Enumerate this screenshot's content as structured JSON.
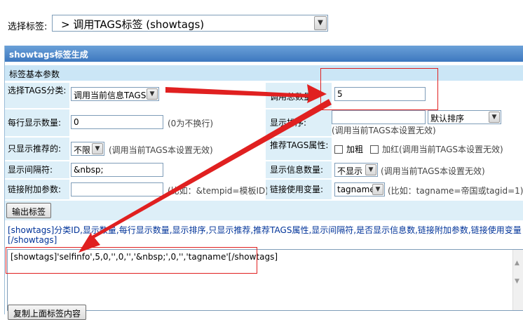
{
  "top": {
    "label": "选择标签:",
    "select_value": "> 调用TAGS标签 (showtags)"
  },
  "panel": {
    "title": "showtags标签生成",
    "section": "标签基本参数"
  },
  "fields": {
    "category_label": "选择TAGS分类:",
    "category_value": "调用当前信息TAGS",
    "total_label": "调用总数量:",
    "total_value": "5",
    "perline_label": "每行显示数量:",
    "perline_value": "0",
    "perline_hint": "(0为不换行)",
    "order_label": "显示排序:",
    "order_value": "",
    "order_select": "默认排序",
    "order_hint": "(调用当前TAGS本设置无效)",
    "recommend_label": "只显示推荐的:",
    "recommend_value": "不限",
    "recommend_hint": "(调用当前TAGS本设置无效)",
    "attr_label": "推荐TAGS属性:",
    "attr_bold": "加粗",
    "attr_red": "加红(调用当前TAGS本设置无效)",
    "sep_label": "显示间隔符:",
    "sep_value": "&nbsp;",
    "count_label": "显示信息数量:",
    "count_value": "不显示",
    "count_hint": "(调用当前TAGS本设置无效)",
    "link_label": "链接附加参数:",
    "link_value": "",
    "link_hint": "(比如：&tempid=模板ID)",
    "var_label": "链接使用变量:",
    "var_value": "tagname",
    "var_hint": "(比如：tagname=帝国或tagid=1)"
  },
  "output_button": "输出标签",
  "description": "[showtags]分类ID,显示数量,每行显示数量,显示排序,只显示推荐,推荐TAGS属性,显示间隔符,是否显示信息数,链接附加参数,链接使用变量[/showtags]",
  "output_text": "[showtags]'selfinfo',5,0,'',0,'','&nbsp;',0,'','tagname'[/showtags]",
  "copy_button": "复制上面标签内容",
  "colors": {
    "header": "#3d78bf",
    "row_bg": "#ddeff8",
    "annotation": "#e02020"
  }
}
